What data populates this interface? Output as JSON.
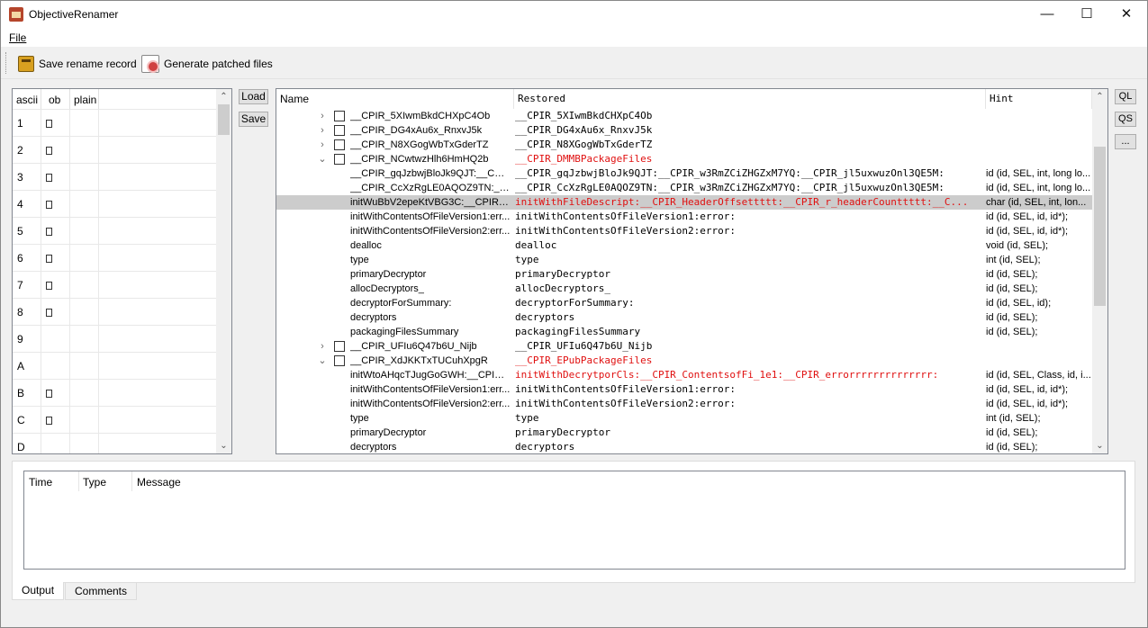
{
  "window": {
    "title": "ObjectiveRenamer",
    "minimize": "—",
    "maximize": "☐",
    "close": "✕"
  },
  "menu": {
    "file": "File"
  },
  "toolbar": {
    "save_record": "Save rename record",
    "generate": "Generate patched files"
  },
  "ascii_table": {
    "headers": [
      "ascii",
      "ob",
      "plain"
    ],
    "rows": [
      {
        "ascii": "1",
        "ob": true
      },
      {
        "ascii": "2",
        "ob": true
      },
      {
        "ascii": "3",
        "ob": true
      },
      {
        "ascii": "4",
        "ob": true
      },
      {
        "ascii": "5",
        "ob": true
      },
      {
        "ascii": "6",
        "ob": true
      },
      {
        "ascii": "7",
        "ob": true
      },
      {
        "ascii": "8",
        "ob": true
      },
      {
        "ascii": "9",
        "ob": false
      },
      {
        "ascii": "A",
        "ob": false
      },
      {
        "ascii": "B",
        "ob": true
      },
      {
        "ascii": "C",
        "ob": true
      },
      {
        "ascii": "D",
        "ob": false
      }
    ]
  },
  "buttons": {
    "load": "Load",
    "save": "Save",
    "ql": "QL",
    "qs": "QS",
    "more": "..."
  },
  "tree": {
    "headers": {
      "name": "Name",
      "restored": "Restored",
      "hint": "Hint"
    },
    "rows": [
      {
        "exp": "›",
        "cb": true,
        "name": "__CPIR_5XIwmBkdCHXpC4Ob",
        "restored": "__CPIR_5XIwmBkdCHXpC4Ob",
        "hint": "",
        "red": false,
        "sel": false
      },
      {
        "exp": "›",
        "cb": true,
        "name": "__CPIR_DG4xAu6x_RnxvJ5k",
        "restored": "__CPIR_DG4xAu6x_RnxvJ5k",
        "hint": "",
        "red": false,
        "sel": false
      },
      {
        "exp": "›",
        "cb": true,
        "name": "__CPIR_N8XGogWbTxGderTZ",
        "restored": "__CPIR_N8XGogWbTxGderTZ",
        "hint": "",
        "red": false,
        "sel": false
      },
      {
        "exp": "⌄",
        "cb": true,
        "name": "__CPIR_NCwtwzHlh6HmHQ2b",
        "restored": "__CPIR_DMMBPackageFiles",
        "hint": "",
        "red": true,
        "sel": false
      },
      {
        "exp": "",
        "cb": false,
        "name": "__CPIR_gqJzbwjBloJk9QJT:__CPIR_...",
        "restored": "__CPIR_gqJzbwjBloJk9QJT:__CPIR_w3RmZCiZHGZxM7YQ:__CPIR_jl5uxwuzOnl3QE5M:",
        "hint": "id (id, SEL, int, long lo...",
        "red": false,
        "sel": false
      },
      {
        "exp": "",
        "cb": false,
        "name": "__CPIR_CcXzRgLE0AQOZ9TN:__C...",
        "restored": "__CPIR_CcXzRgLE0AQOZ9TN:__CPIR_w3RmZCiZHGZxM7YQ:__CPIR_jl5uxwuzOnl3QE5M:",
        "hint": "id (id, SEL, int, long lo...",
        "red": false,
        "sel": false
      },
      {
        "exp": "",
        "cb": false,
        "name": "initWuBbV2epeKtVBG3C:__CPIR_...",
        "restored": "initWithFileDescript:__CPIR_HeaderOffsettttt:__CPIR_r_headerCounttttt:__C...",
        "hint": "char (id, SEL, int, lon...",
        "red": true,
        "sel": true
      },
      {
        "exp": "",
        "cb": false,
        "name": "initWithContentsOfFileVersion1:err...",
        "restored": "initWithContentsOfFileVersion1:error:",
        "hint": "id (id, SEL, id, id*);",
        "red": false,
        "sel": false
      },
      {
        "exp": "",
        "cb": false,
        "name": "initWithContentsOfFileVersion2:err...",
        "restored": "initWithContentsOfFileVersion2:error:",
        "hint": "id (id, SEL, id, id*);",
        "red": false,
        "sel": false
      },
      {
        "exp": "",
        "cb": false,
        "name": "dealloc",
        "restored": "dealloc",
        "hint": "void (id, SEL);",
        "red": false,
        "sel": false
      },
      {
        "exp": "",
        "cb": false,
        "name": "type",
        "restored": "type",
        "hint": "int (id, SEL);",
        "red": false,
        "sel": false
      },
      {
        "exp": "",
        "cb": false,
        "name": "primaryDecryptor",
        "restored": "primaryDecryptor",
        "hint": "id (id, SEL);",
        "red": false,
        "sel": false
      },
      {
        "exp": "",
        "cb": false,
        "name": "allocDecryptors_",
        "restored": "allocDecryptors_",
        "hint": "id (id, SEL);",
        "red": false,
        "sel": false
      },
      {
        "exp": "",
        "cb": false,
        "name": "decryptorForSummary:",
        "restored": "decryptorForSummary:",
        "hint": "id (id, SEL, id);",
        "red": false,
        "sel": false
      },
      {
        "exp": "",
        "cb": false,
        "name": "decryptors",
        "restored": "decryptors",
        "hint": "id (id, SEL);",
        "red": false,
        "sel": false
      },
      {
        "exp": "",
        "cb": false,
        "name": "packagingFilesSummary",
        "restored": "packagingFilesSummary",
        "hint": "id (id, SEL);",
        "red": false,
        "sel": false
      },
      {
        "exp": "›",
        "cb": true,
        "name": "__CPIR_UFIu6Q47b6U_Nijb",
        "restored": "__CPIR_UFIu6Q47b6U_Nijb",
        "hint": "",
        "red": false,
        "sel": false
      },
      {
        "exp": "⌄",
        "cb": true,
        "name": "__CPIR_XdJKKTxTUCuhXpgR",
        "restored": "__CPIR_EPubPackageFiles",
        "hint": "",
        "red": true,
        "sel": false
      },
      {
        "exp": "",
        "cb": false,
        "name": "initWtoAHqcTJugGoGWH:__CPIR_...",
        "restored": "initWithDecrytporCls:__CPIR_ContentsofFi_1e1:__CPIR_errorrrrrrrrrrrrrr:",
        "hint": "id (id, SEL, Class, id, i...",
        "red": true,
        "sel": false
      },
      {
        "exp": "",
        "cb": false,
        "name": "initWithContentsOfFileVersion1:err...",
        "restored": "initWithContentsOfFileVersion1:error:",
        "hint": "id (id, SEL, id, id*);",
        "red": false,
        "sel": false
      },
      {
        "exp": "",
        "cb": false,
        "name": "initWithContentsOfFileVersion2:err...",
        "restored": "initWithContentsOfFileVersion2:error:",
        "hint": "id (id, SEL, id, id*);",
        "red": false,
        "sel": false
      },
      {
        "exp": "",
        "cb": false,
        "name": "type",
        "restored": "type",
        "hint": "int (id, SEL);",
        "red": false,
        "sel": false
      },
      {
        "exp": "",
        "cb": false,
        "name": "primaryDecryptor",
        "restored": "primaryDecryptor",
        "hint": "id (id, SEL);",
        "red": false,
        "sel": false
      },
      {
        "exp": "",
        "cb": false,
        "name": "decryptors",
        "restored": "decryptors",
        "hint": "id (id, SEL);",
        "red": false,
        "sel": false
      }
    ]
  },
  "log": {
    "headers": [
      "Time",
      "Type",
      "Message"
    ]
  },
  "tabs": [
    {
      "label": "Output",
      "active": true
    },
    {
      "label": "Comments",
      "active": false
    }
  ],
  "icons": {
    "expand": "chevron-right-icon",
    "collapse": "chevron-down-icon",
    "scroll_up": "scroll-up-icon",
    "scroll_down": "scroll-down-icon"
  },
  "colors": {
    "restored_changed": "#e01010",
    "selection": "#cccccc"
  }
}
